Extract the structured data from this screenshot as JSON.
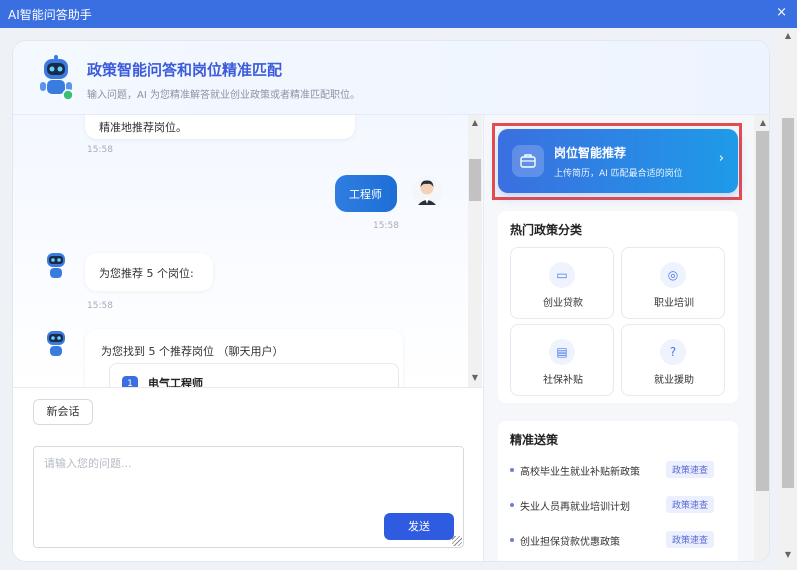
{
  "window": {
    "title": "AI智能问答助手",
    "close_glyph": "×"
  },
  "header": {
    "title": "政策智能问答和岗位精准匹配",
    "subtitle": "输入问题，AI 为您精准解答就业创业政策或者精准匹配职位。"
  },
  "chat": {
    "messages": [
      {
        "role": "bot",
        "text": "精准地推荐岗位。",
        "time": "15:58"
      },
      {
        "role": "user",
        "text": "工程师",
        "time": "15:58"
      },
      {
        "role": "bot",
        "text": "为您推荐 5 个岗位:",
        "time": "15:58"
      },
      {
        "role": "bot",
        "text": "为您找到 5 个推荐岗位 （聊天用户）"
      }
    ],
    "job": {
      "index": "1",
      "name": "电气工程师"
    }
  },
  "input": {
    "new_chat_label": "新会话",
    "placeholder": "请输入您的问题...",
    "send_label": "发送"
  },
  "promo": {
    "title": "岗位智能推荐",
    "subtitle": "上传简历，AI 匹配最合适的岗位",
    "arrow": "›"
  },
  "categories": {
    "title": "热门政策分类",
    "items": [
      {
        "label": "创业贷款",
        "icon": "book-icon"
      },
      {
        "label": "职业培训",
        "icon": "compass-icon"
      },
      {
        "label": "社保补贴",
        "icon": "document-icon"
      },
      {
        "label": "就业援助",
        "icon": "help-icon"
      }
    ]
  },
  "policies": {
    "title": "精准送策",
    "items": [
      {
        "text": "高校毕业生就业补贴新政策",
        "tag": "政策速查"
      },
      {
        "text": "失业人员再就业培训计划",
        "tag": "政策速查"
      },
      {
        "text": "创业担保贷款优惠政策",
        "tag": "政策速查"
      }
    ]
  },
  "colors": {
    "titlebar": "#3a6fe2",
    "accent": "#3b5bdb",
    "send": "#2e5be0",
    "highlight": "#e74c4c"
  }
}
